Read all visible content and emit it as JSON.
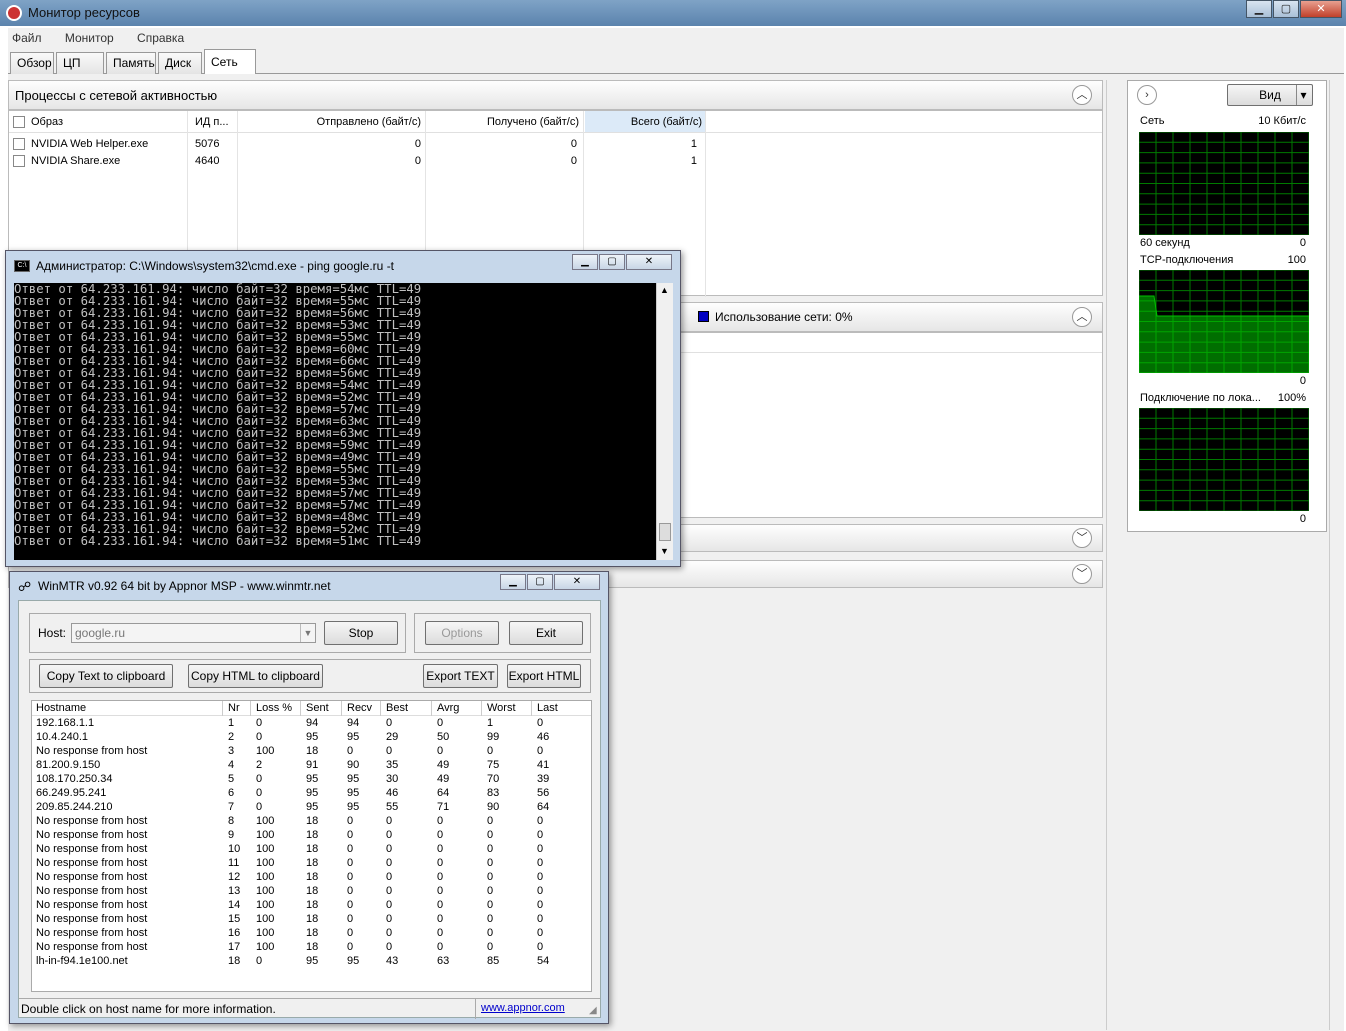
{
  "app": {
    "title": "Монитор ресурсов",
    "menu": [
      "Файл",
      "Монитор",
      "Справка"
    ],
    "tabs": [
      "Обзор",
      "ЦП",
      "Память",
      "Диск",
      "Сеть"
    ],
    "active_tab": "Сеть"
  },
  "processes": {
    "header": "Процессы с сетевой активностью",
    "columns": [
      "Образ",
      "ИД п...",
      "Отправлено (байт/с)",
      "Получено (байт/с)",
      "Всего (байт/с)"
    ],
    "rows": [
      {
        "image": "NVIDIA Web Helper.exe",
        "pid": "5076",
        "sent": "0",
        "recv": "0",
        "total": "1"
      },
      {
        "image": "NVIDIA Share.exe",
        "pid": "4640",
        "sent": "0",
        "recv": "0",
        "total": "1"
      }
    ]
  },
  "network": {
    "usage_label": "Использование сети: 0%",
    "usage_color": "#0000c0"
  },
  "right_panel": {
    "view_label": "Вид",
    "graphs": [
      {
        "name": "Сеть",
        "max": "10 Кбит/с",
        "bottom_left": "60 секунд",
        "bottom_right": "0"
      },
      {
        "name": "TCP-подключения",
        "max": "100",
        "bottom_left": "",
        "bottom_right": "0"
      },
      {
        "name": "Подключение по лока...",
        "max": "100%",
        "bottom_left": "",
        "bottom_right": "0"
      }
    ],
    "graph_color": "#00c000"
  },
  "cmd": {
    "title": "Администратор: C:\\Windows\\system32\\cmd.exe - ping  google.ru -t",
    "lines": [
      "Ответ от 64.233.161.94: число байт=32 время=54мс TTL=49",
      "Ответ от 64.233.161.94: число байт=32 время=55мс TTL=49",
      "Ответ от 64.233.161.94: число байт=32 время=56мс TTL=49",
      "Ответ от 64.233.161.94: число байт=32 время=53мс TTL=49",
      "Ответ от 64.233.161.94: число байт=32 время=55мс TTL=49",
      "Ответ от 64.233.161.94: число байт=32 время=60мс TTL=49",
      "Ответ от 64.233.161.94: число байт=32 время=66мс TTL=49",
      "Ответ от 64.233.161.94: число байт=32 время=56мс TTL=49",
      "Ответ от 64.233.161.94: число байт=32 время=54мс TTL=49",
      "Ответ от 64.233.161.94: число байт=32 время=52мс TTL=49",
      "Ответ от 64.233.161.94: число байт=32 время=57мс TTL=49",
      "Ответ от 64.233.161.94: число байт=32 время=63мс TTL=49",
      "Ответ от 64.233.161.94: число байт=32 время=63мс TTL=49",
      "Ответ от 64.233.161.94: число байт=32 время=59мс TTL=49",
      "Ответ от 64.233.161.94: число байт=32 время=49мс TTL=49",
      "Ответ от 64.233.161.94: число байт=32 время=55мс TTL=49",
      "Ответ от 64.233.161.94: число байт=32 время=53мс TTL=49",
      "Ответ от 64.233.161.94: число байт=32 время=57мс TTL=49",
      "Ответ от 64.233.161.94: число байт=32 время=57мс TTL=49",
      "Ответ от 64.233.161.94: число байт=32 время=48мс TTL=49",
      "Ответ от 64.233.161.94: число байт=32 время=52мс TTL=49",
      "Ответ от 64.233.161.94: число байт=32 время=51мс TTL=49"
    ]
  },
  "winmtr": {
    "title": "WinMTR v0.92 64 bit by Appnor MSP - www.winmtr.net",
    "host_label": "Host:",
    "host_value": "google.ru",
    "stop": "Stop",
    "options": "Options",
    "exit": "Exit",
    "copy_text": "Copy Text to clipboard",
    "copy_html": "Copy HTML to clipboard",
    "export_text": "Export TEXT",
    "export_html": "Export HTML",
    "columns": [
      "Hostname",
      "Nr",
      "Loss %",
      "Sent",
      "Recv",
      "Best",
      "Avrg",
      "Worst",
      "Last"
    ],
    "rows": [
      [
        "192.168.1.1",
        "1",
        "0",
        "94",
        "94",
        "0",
        "0",
        "1",
        "0"
      ],
      [
        "10.4.240.1",
        "2",
        "0",
        "95",
        "95",
        "29",
        "50",
        "99",
        "46"
      ],
      [
        "No response from host",
        "3",
        "100",
        "18",
        "0",
        "0",
        "0",
        "0",
        "0"
      ],
      [
        "81.200.9.150",
        "4",
        "2",
        "91",
        "90",
        "35",
        "49",
        "75",
        "41"
      ],
      [
        "108.170.250.34",
        "5",
        "0",
        "95",
        "95",
        "30",
        "49",
        "70",
        "39"
      ],
      [
        "66.249.95.241",
        "6",
        "0",
        "95",
        "95",
        "46",
        "64",
        "83",
        "56"
      ],
      [
        "209.85.244.210",
        "7",
        "0",
        "95",
        "95",
        "55",
        "71",
        "90",
        "64"
      ],
      [
        "No response from host",
        "8",
        "100",
        "18",
        "0",
        "0",
        "0",
        "0",
        "0"
      ],
      [
        "No response from host",
        "9",
        "100",
        "18",
        "0",
        "0",
        "0",
        "0",
        "0"
      ],
      [
        "No response from host",
        "10",
        "100",
        "18",
        "0",
        "0",
        "0",
        "0",
        "0"
      ],
      [
        "No response from host",
        "11",
        "100",
        "18",
        "0",
        "0",
        "0",
        "0",
        "0"
      ],
      [
        "No response from host",
        "12",
        "100",
        "18",
        "0",
        "0",
        "0",
        "0",
        "0"
      ],
      [
        "No response from host",
        "13",
        "100",
        "18",
        "0",
        "0",
        "0",
        "0",
        "0"
      ],
      [
        "No response from host",
        "14",
        "100",
        "18",
        "0",
        "0",
        "0",
        "0",
        "0"
      ],
      [
        "No response from host",
        "15",
        "100",
        "18",
        "0",
        "0",
        "0",
        "0",
        "0"
      ],
      [
        "No response from host",
        "16",
        "100",
        "18",
        "0",
        "0",
        "0",
        "0",
        "0"
      ],
      [
        "No response from host",
        "17",
        "100",
        "18",
        "0",
        "0",
        "0",
        "0",
        "0"
      ],
      [
        "lh-in-f94.1e100.net",
        "18",
        "0",
        "95",
        "95",
        "43",
        "63",
        "85",
        "54"
      ]
    ],
    "status": "Double click on host name for more information.",
    "link": "www.appnor.com"
  }
}
